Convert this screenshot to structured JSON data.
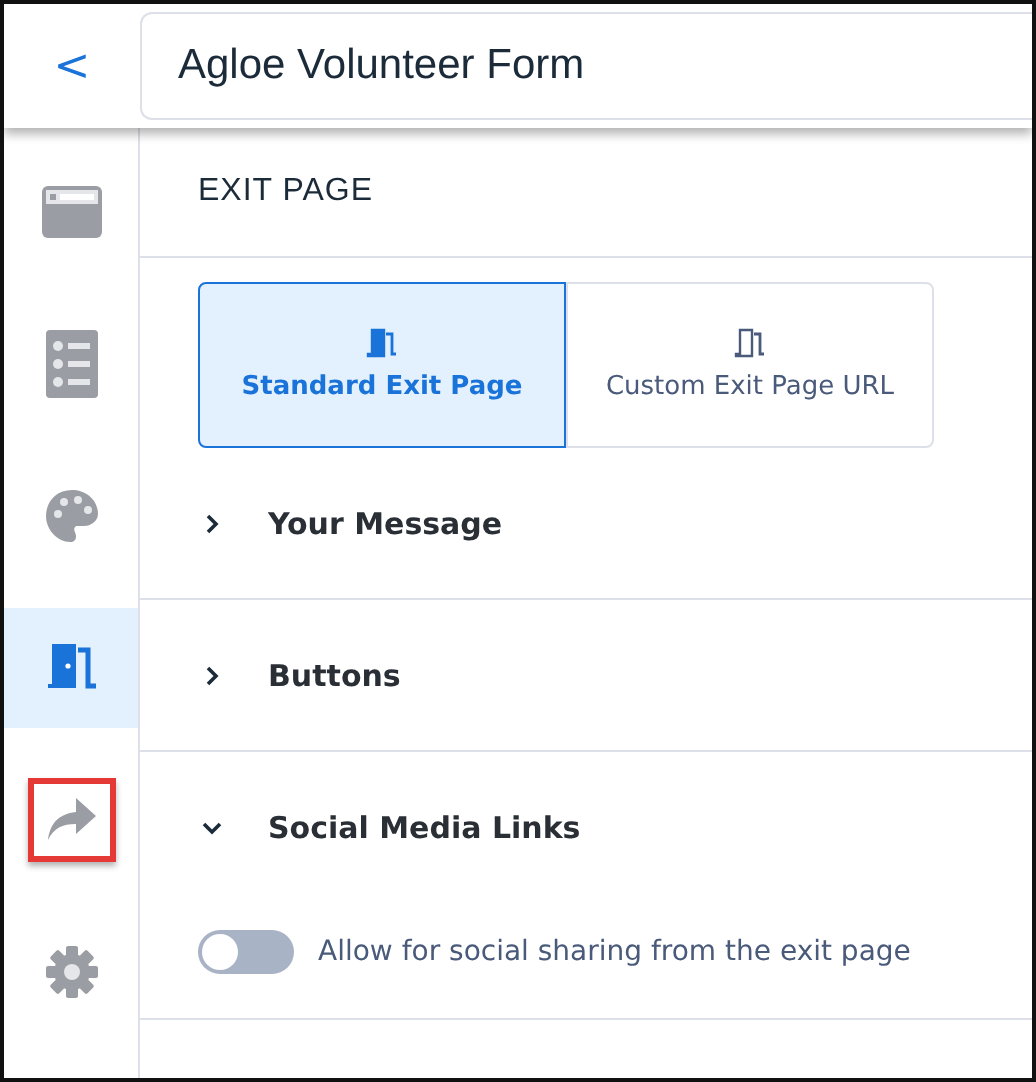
{
  "header": {
    "back": "<",
    "title": "Agloe Volunteer Form"
  },
  "sidebar": {
    "items": [
      {
        "kind": "layout",
        "selected": false,
        "highlighted": false
      },
      {
        "kind": "list",
        "selected": false,
        "highlighted": false
      },
      {
        "kind": "palette",
        "selected": false,
        "highlighted": false
      },
      {
        "kind": "door",
        "selected": true,
        "highlighted": false
      },
      {
        "kind": "share",
        "selected": false,
        "highlighted": true
      },
      {
        "kind": "gear",
        "selected": false,
        "highlighted": false
      }
    ]
  },
  "section_title": "EXIT PAGE",
  "exit_options": [
    {
      "label": "Standard Exit Page",
      "selected": true
    },
    {
      "label": "Custom Exit Page URL",
      "selected": false
    }
  ],
  "panels": [
    {
      "title": "Your Message",
      "expanded": false
    },
    {
      "title": "Buttons",
      "expanded": false
    },
    {
      "title": "Social Media Links",
      "expanded": true,
      "toggle": {
        "label": "Allow for social sharing from the exit page",
        "on": false
      }
    }
  ]
}
